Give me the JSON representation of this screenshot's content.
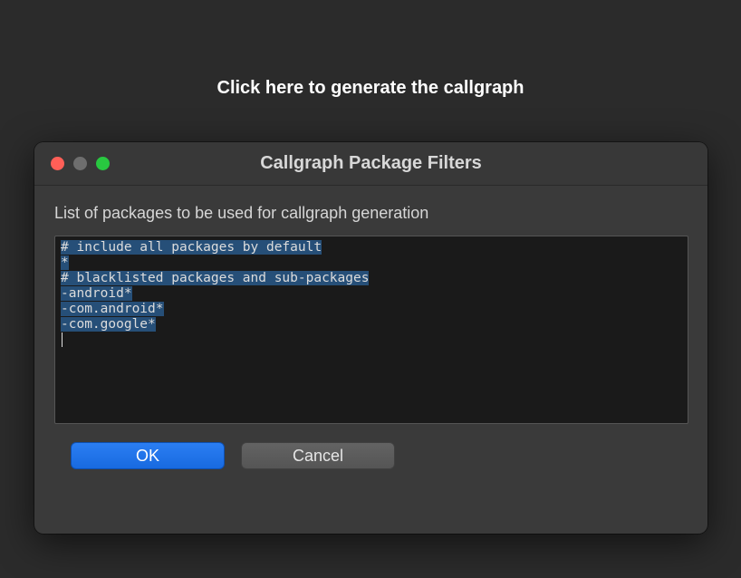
{
  "banner": {
    "text": "Click here to generate the callgraph"
  },
  "dialog": {
    "title": "Callgraph Package Filters",
    "section_label": "List of packages to be used for callgraph generation",
    "editor_lines": [
      "# include all packages by default",
      "*",
      "# blacklisted packages and sub-packages",
      "-android*",
      "-com.android*",
      "-com.google*"
    ],
    "buttons": {
      "ok": "OK",
      "cancel": "Cancel"
    }
  }
}
